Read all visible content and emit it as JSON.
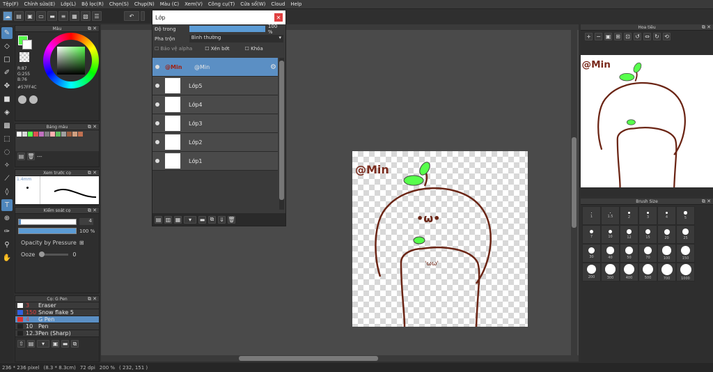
{
  "menu": [
    "Tệp(F)",
    "Chỉnh sửa(E)",
    "Lớp(L)",
    "Bộ lọc(R)",
    "Chọn(S)",
    "Chụp(N)",
    "Màu (C)",
    "Xem(V)",
    "Công cụ(T)",
    "Cửa sổ(W)",
    "Cloud",
    "Help"
  ],
  "color_panel": {
    "title": "Màu",
    "r": "R:87",
    "g": "G:255",
    "b": "B:76",
    "hex": "#57FF4C",
    "fg": "#57FF4C"
  },
  "palette_panel": {
    "title": "Bảng màu",
    "ellipsis": "---",
    "swatches": [
      "#ffffff",
      "#d9d9d9",
      "#57ff4c",
      "#e05050",
      "#c070c0",
      "#808080",
      "#ffb0b0",
      "#60c060",
      "#a0a0a0",
      "#a06040",
      "#d0a080",
      "#c07050"
    ]
  },
  "preview_panel": {
    "title": "Xem trước cọ",
    "size": "1.4mm"
  },
  "brushctl_panel": {
    "title": "Kiểm soát cọ",
    "size_val": "4",
    "opacity_val": "100 %",
    "opacity_pressure": "Opacity by Pressure",
    "ooze_label": "Ooze",
    "ooze_val": "0"
  },
  "brush_list": {
    "title": "Cọ: G Pen",
    "items": [
      {
        "size": "3",
        "name": "Eraser",
        "color": "#ffffff",
        "selected": false
      },
      {
        "size": "150",
        "name": "Snow flake 5",
        "color": "#3060e0",
        "selected": false
      },
      {
        "size": "4",
        "name": "G Pen",
        "color": "#e03030",
        "selected": true
      },
      {
        "size": "10",
        "name": "Pen",
        "color": "#222222",
        "selected": false
      },
      {
        "size": "12.3",
        "name": "Pen (Sharp)",
        "color": "#222222",
        "selected": false
      }
    ]
  },
  "layer_win": {
    "title": "Lớp",
    "opacity_label": "Độ trong",
    "opacity_val": "100 %",
    "blend_label": "Pha trộn",
    "blend_val": "Bình thường",
    "protect_alpha": "Bảo vệ alpha",
    "clip": "Xén bớt",
    "lock": "Khóa",
    "layers": [
      {
        "name": "@Min",
        "thumb": "@Min",
        "selected": true
      },
      {
        "name": "Lớp5",
        "selected": false
      },
      {
        "name": "Lớp4",
        "selected": false
      },
      {
        "name": "Lớp3",
        "selected": false
      },
      {
        "name": "Lớp2",
        "selected": false
      },
      {
        "name": "Lớp1",
        "selected": false
      }
    ]
  },
  "canvas": {
    "text": "@Min",
    "eyes": "•ω•",
    "small_face": "'ωω'"
  },
  "navigator": {
    "title": "Hoa tiêu",
    "text": "@Min"
  },
  "brush_size": {
    "title": "Brush Size",
    "sizes": [
      "1",
      "1.5",
      "2",
      "3",
      "4",
      "5",
      "7",
      "10",
      "12",
      "15",
      "20",
      "25",
      "30",
      "40",
      "50",
      "70",
      "100",
      "150",
      "200",
      "300",
      "400",
      "500",
      "700",
      "1000"
    ]
  },
  "status": {
    "size": "236 * 236 pixel",
    "cm": "(8.3 * 8.3cm)",
    "dpi": "72 dpi",
    "zoom": "200 %",
    "coords": "( 232, 151 )"
  }
}
